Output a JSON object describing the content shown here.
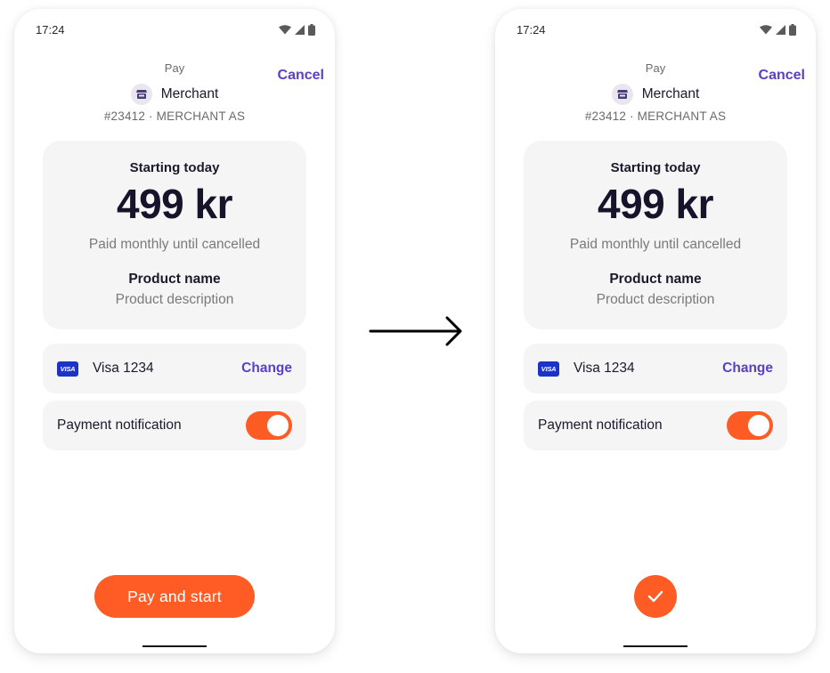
{
  "screens": [
    {
      "id": "before",
      "status_bar": {
        "time": "17:24",
        "icons": [
          "wifi-icon",
          "signal-icon",
          "battery-icon"
        ]
      },
      "header": {
        "title": "Pay",
        "cancel_label": "Cancel",
        "merchant_icon": "store-icon",
        "merchant_name": "Merchant",
        "merchant_id": "#23412 · MERCHANT AS"
      },
      "summary": {
        "starting_label": "Starting today",
        "amount": "499 kr",
        "recurrence": "Paid monthly until cancelled",
        "product_name": "Product name",
        "product_description": "Product description"
      },
      "payment_method": {
        "brand_badge": "VISA",
        "label": "Visa 1234",
        "change_label": "Change"
      },
      "notification": {
        "label": "Payment notification",
        "enabled": true
      },
      "primary_action": {
        "label": "Pay and start"
      }
    },
    {
      "id": "after",
      "status_bar": {
        "time": "17:24",
        "icons": [
          "wifi-icon",
          "signal-icon",
          "battery-icon"
        ]
      },
      "header": {
        "title": "Pay",
        "cancel_label": "Cancel",
        "merchant_icon": "store-icon",
        "merchant_name": "Merchant",
        "merchant_id": "#23412 · MERCHANT AS"
      },
      "summary": {
        "starting_label": "Starting today",
        "amount": "499 kr",
        "recurrence": "Paid monthly until cancelled",
        "product_name": "Product name",
        "product_description": "Product description"
      },
      "payment_method": {
        "brand_badge": "VISA",
        "label": "Visa 1234",
        "change_label": "Change"
      },
      "notification": {
        "label": "Payment notification",
        "enabled": true
      },
      "primary_action": {
        "icon": "checkmark-icon",
        "state": "success"
      }
    }
  ],
  "transition_icon": "arrow-right-icon",
  "colors": {
    "accent": "#ff5b24",
    "link": "#5b3fc4",
    "card_background": "#f5f5f5",
    "text_primary": "#1b1a2a",
    "text_secondary": "#7a7a7a",
    "visa_blue": "#1b33c9"
  }
}
